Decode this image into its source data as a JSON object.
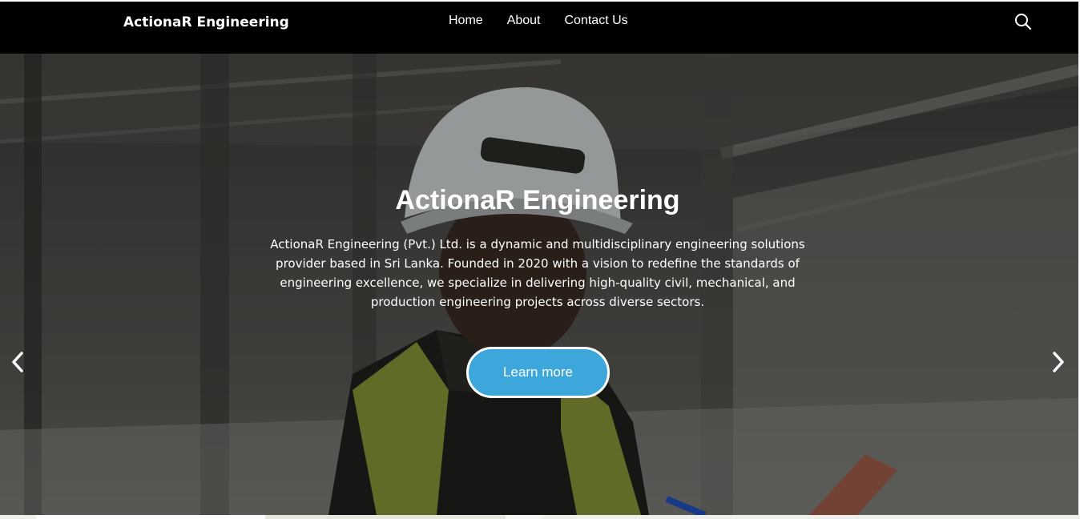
{
  "navbar": {
    "brand": "ActionaR Engineering",
    "links": [
      {
        "label": "Home"
      },
      {
        "label": "About"
      },
      {
        "label": "Contact Us"
      }
    ],
    "search_icon": "search-icon"
  },
  "hero": {
    "title": "ActionaR Engineering",
    "description": "ActionaR Engineering (Pvt.) Ltd. is a dynamic and multidisciplinary engineering solutions provider based in Sri Lanka. Founded in 2020 with a vision to redefine the standards of engineering excellence, we specialize in delivering high-quality civil, mechanical, and production engineering projects across diverse sectors.",
    "cta_label": "Learn more",
    "prev_icon": "chevron-left-icon",
    "next_icon": "chevron-right-icon"
  },
  "colors": {
    "navbar_bg": "#000000",
    "cta_bg": "#3da6db",
    "text": "#ffffff"
  }
}
